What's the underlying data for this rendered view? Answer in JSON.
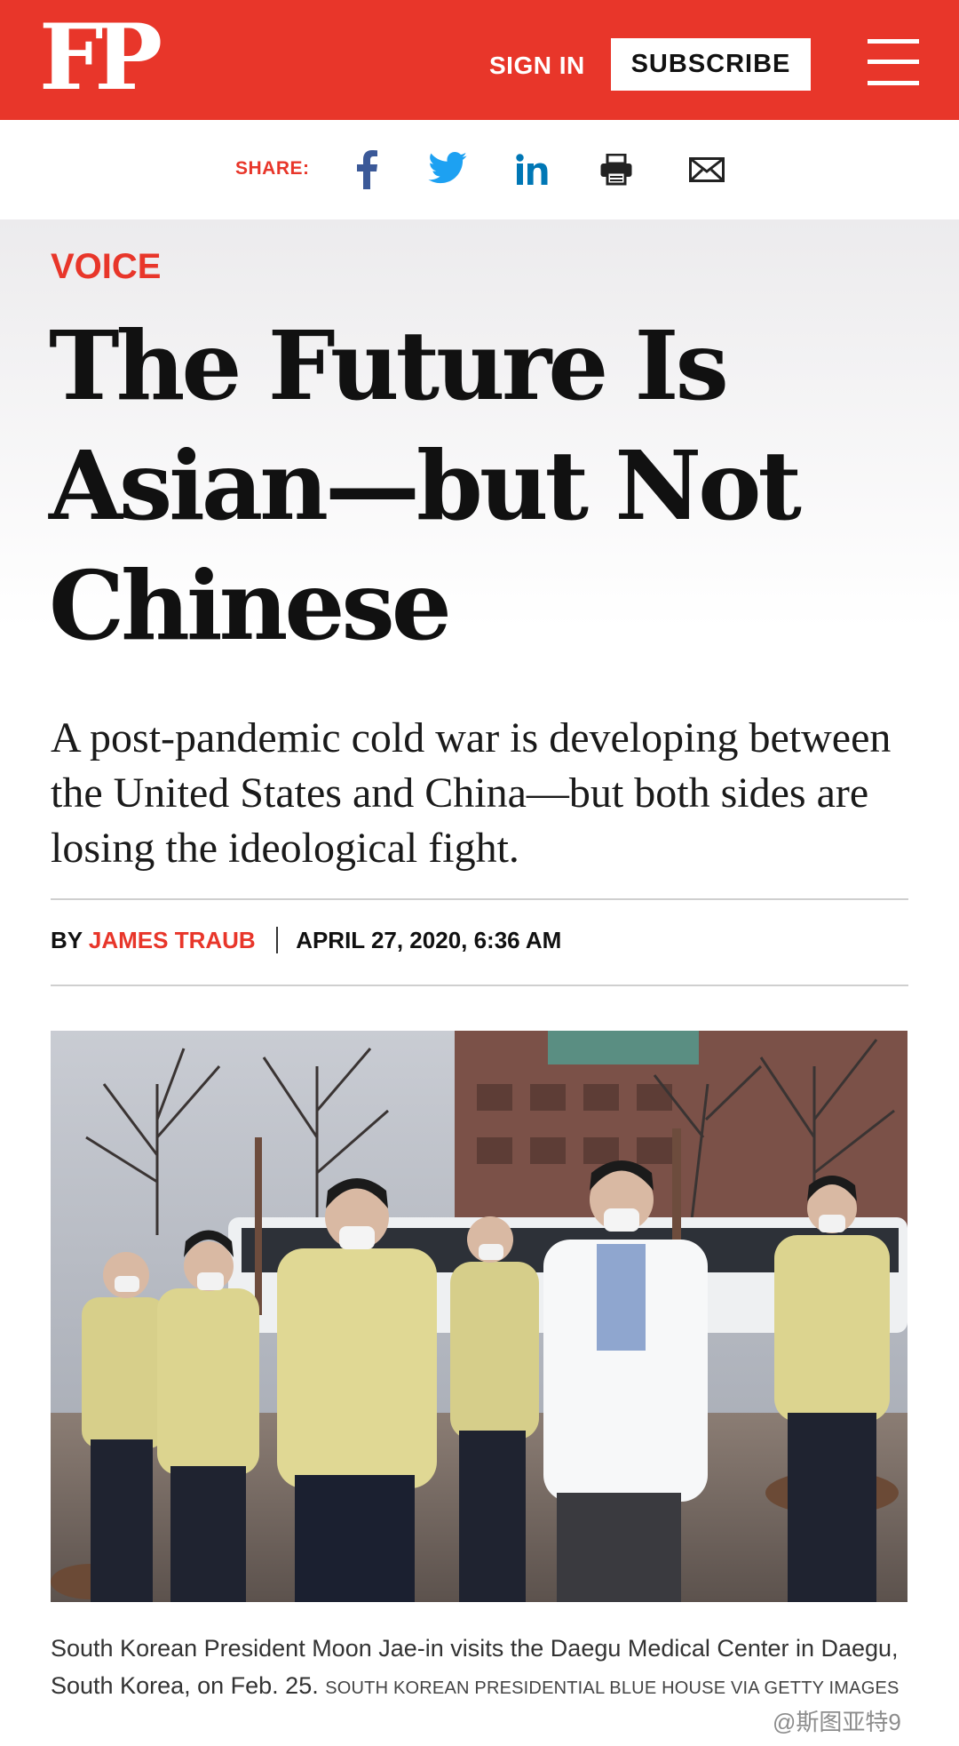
{
  "header": {
    "logo_text": "FP",
    "sign_in_label": "SIGN IN",
    "subscribe_label": "SUBSCRIBE",
    "brand_color": "#e8362a"
  },
  "share": {
    "label": "SHARE:",
    "icons": [
      "facebook-icon",
      "twitter-icon",
      "linkedin-icon",
      "print-icon",
      "email-icon"
    ]
  },
  "article": {
    "section": "VOICE",
    "headline": "The Future Is Asian—but Not Chinese",
    "dek": "A post-pandemic cold war is developing between the United States and China—but both sides are losing the ideological fight.",
    "byline_prefix": "BY",
    "author": "JAMES TRAUB",
    "date": "APRIL 27, 2020, 6:36 AM"
  },
  "photo": {
    "caption": "South Korean President Moon Jae-in visits the Daegu Medical Center in Daegu, South Korea, on Feb. 25.",
    "credit": "SOUTH KOREAN PRESIDENTIAL BLUE HOUSE VIA GETTY IMAGES"
  },
  "watermark": "@斯图亚特9"
}
